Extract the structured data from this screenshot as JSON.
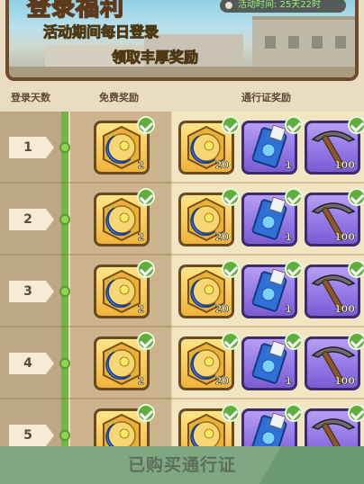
{
  "banner": {
    "title": "登录福利",
    "line1": "活动期间每日登录",
    "line2": "领取丰厚奖励",
    "timer": "活动时间: 25天22时"
  },
  "headers": {
    "days": "登录天数",
    "free": "免费奖励",
    "pass": "通行证奖励"
  },
  "icons": {
    "free_reward": "gold-hexagon-blue-crescent-icon",
    "pass_coin": "gold-hexagon-blue-crescent-icon",
    "pass_ticket": "blue-ticket-card-icon",
    "pass_pickaxe": "pickaxe-icon",
    "claimed": "green-checkmark-icon"
  },
  "colors": {
    "track": "#74b446",
    "claimed_check": "#5fae3e",
    "gold_tile": "#f0b43a",
    "purple_tile": "#7a5bd6"
  },
  "rows": [
    {
      "day": "1",
      "free_qty": "2",
      "pass": [
        "20",
        "1",
        "100"
      ]
    },
    {
      "day": "2",
      "free_qty": "2",
      "pass": [
        "20",
        "1",
        "100"
      ]
    },
    {
      "day": "3",
      "free_qty": "2",
      "pass": [
        "20",
        "1",
        "100"
      ]
    },
    {
      "day": "4",
      "free_qty": "2",
      "pass": [
        "20",
        "1",
        "100"
      ]
    },
    {
      "day": "5",
      "free_qty": "",
      "pass": [
        "",
        "",
        ""
      ]
    }
  ],
  "bottom": {
    "button_label": "已购买通行证"
  }
}
